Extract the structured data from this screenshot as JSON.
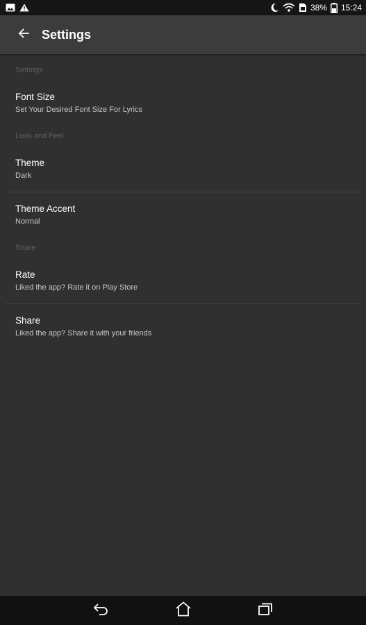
{
  "status_bar": {
    "battery_percent": "38%",
    "time": "15:24",
    "icons": [
      "gallery-icon",
      "warning-icon",
      "moon-icon",
      "wifi-icon",
      "sim-icon",
      "battery-icon"
    ]
  },
  "app_bar": {
    "title": "Settings",
    "back_icon": "arrow-back-icon"
  },
  "sections": [
    {
      "header": "Settings",
      "items": [
        {
          "title": "Font Size",
          "summary": "Set Your Desired Font Size For Lyrics"
        }
      ]
    },
    {
      "header": "Look and Feel",
      "items": [
        {
          "title": "Theme",
          "summary": "Dark"
        },
        {
          "title": "Theme Accent",
          "summary": "Normal"
        }
      ]
    },
    {
      "header": "Share",
      "items": [
        {
          "title": "Rate",
          "summary": "Liked the app? Rate it on Play Store"
        },
        {
          "title": "Share",
          "summary": "Liked the app? Share it with your friends"
        }
      ]
    }
  ],
  "nav_bar": {
    "icons": [
      "back-icon",
      "home-icon",
      "recents-icon"
    ]
  },
  "colors": {
    "background": "#303030",
    "app_bar": "#3c3c3c",
    "status_bar": "#161616",
    "nav_bar": "#111111",
    "section_header": "#5f5f5f"
  }
}
